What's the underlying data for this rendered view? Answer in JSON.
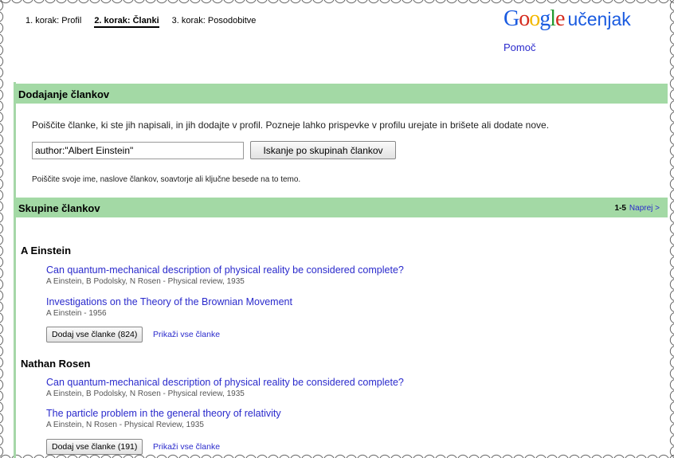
{
  "steps": [
    {
      "label": "1. korak: Profil"
    },
    {
      "label": "2. korak: Članki"
    },
    {
      "label": "3. korak: Posodobitve"
    }
  ],
  "logo": {
    "g1": "G",
    "o1": "o",
    "o2": "o",
    "g2": "g",
    "l": "l",
    "e": "e",
    "sub": "učenjak"
  },
  "help": "Pomoč",
  "add_section": {
    "title": "Dodajanje člankov",
    "intro": "Poiščite članke, ki ste jih napisali, in jih dodajte v profil. Pozneje lahko prispevke v profilu urejate in brišete ali dodate nove.",
    "search_value": "author:\"Albert Einstein\"",
    "search_button": "Iskanje po skupinah člankov",
    "hint": "Poiščite svoje ime, naslove člankov, soavtorje ali ključne besede na to temo."
  },
  "groups_section": {
    "title": "Skupine člankov",
    "range": "1-5",
    "next": "Naprej >"
  },
  "groups": [
    {
      "name": "A Einstein",
      "articles": [
        {
          "title": "Can quantum-mechanical description of physical reality be considered complete?",
          "meta": "A Einstein, B Podolsky, N Rosen - Physical review, 1935"
        },
        {
          "title": "Investigations on the Theory of the Brownian Movement",
          "meta": "A Einstein - 1956"
        }
      ],
      "add_button": "Dodaj vse članke (824)",
      "show_all": "Prikaži vse članke"
    },
    {
      "name": "Nathan Rosen",
      "articles": [
        {
          "title": "Can quantum-mechanical description of physical reality be considered complete?",
          "meta": "A Einstein, B Podolsky, N Rosen - Physical review, 1935"
        },
        {
          "title": "The particle problem in the general theory of relativity",
          "meta": "A Einstein, N Rosen - Physical Review, 1935"
        }
      ],
      "add_button": "Dodaj vse članke (191)",
      "show_all": "Prikaži vse članke"
    }
  ],
  "colors": {
    "section_bar": "#a3d9a5",
    "link": "#2a2acc"
  }
}
